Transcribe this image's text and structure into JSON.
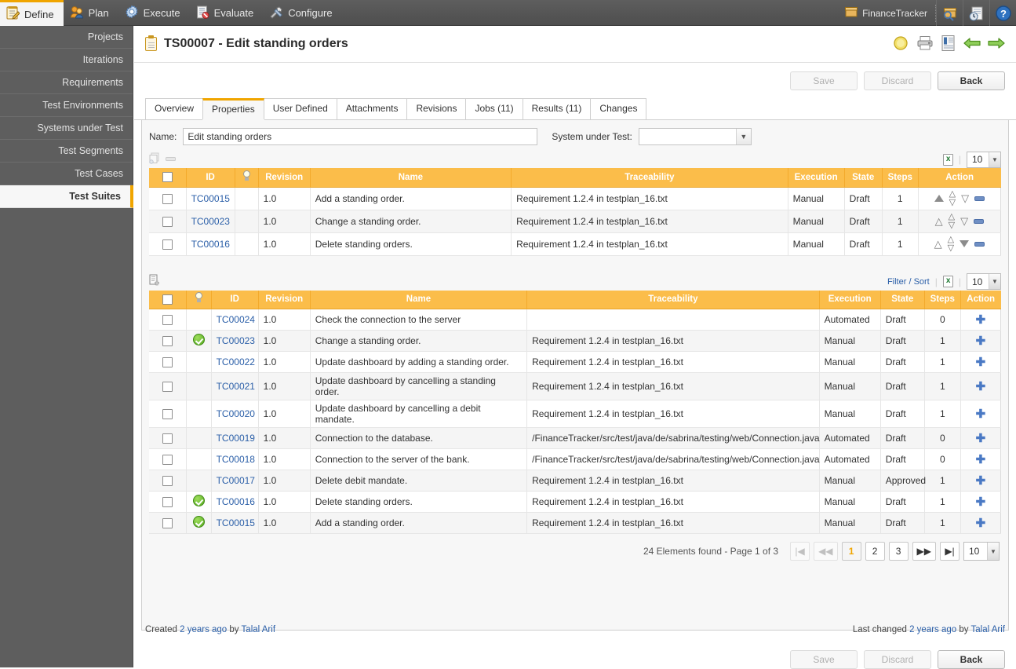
{
  "topnav": {
    "items": [
      {
        "label": "Define",
        "icon": "notepad-icon",
        "active": true
      },
      {
        "label": "Plan",
        "icon": "people-icon",
        "active": false
      },
      {
        "label": "Execute",
        "icon": "gear-icon",
        "active": false
      },
      {
        "label": "Evaluate",
        "icon": "report-icon",
        "active": false
      },
      {
        "label": "Configure",
        "icon": "tools-icon",
        "active": false
      }
    ],
    "project_label": "FinanceTracker",
    "right_icons": [
      "search-package-icon",
      "history-icon",
      "help-icon"
    ]
  },
  "sidebar": {
    "items": [
      {
        "label": "Projects",
        "active": false
      },
      {
        "label": "Iterations",
        "active": false
      },
      {
        "label": "Requirements",
        "active": false
      },
      {
        "label": "Test Environments",
        "active": false
      },
      {
        "label": "Systems under Test",
        "active": false
      },
      {
        "label": "Test Segments",
        "active": false
      },
      {
        "label": "Test Cases",
        "active": false
      },
      {
        "label": "Test Suites",
        "active": true
      }
    ]
  },
  "page": {
    "title": "TS00007 - Edit standing orders",
    "title_icon": "clipboard-icon",
    "header_icons": [
      "bulb-icon",
      "print-icon",
      "report-icon",
      "back-arrow-icon",
      "forward-arrow-icon"
    ]
  },
  "actions": {
    "save": "Save",
    "discard": "Discard",
    "back": "Back"
  },
  "tabs": [
    {
      "label": "Overview",
      "active": false
    },
    {
      "label": "Properties",
      "active": true
    },
    {
      "label": "User Defined",
      "active": false
    },
    {
      "label": "Attachments",
      "active": false
    },
    {
      "label": "Revisions",
      "active": false
    },
    {
      "label": "Jobs (11)",
      "active": false
    },
    {
      "label": "Results (11)",
      "active": false
    },
    {
      "label": "Changes",
      "active": false
    }
  ],
  "form": {
    "name_label": "Name:",
    "name_value": "Edit standing orders",
    "sut_label": "System under Test:",
    "sut_value": ""
  },
  "table1": {
    "toolbar": {
      "copy_icon": "copy-disabled-icon",
      "remove_icon": "remove-disabled-icon",
      "export_icon": "excel-export-icon",
      "page_size": "10"
    },
    "columns": [
      "",
      "ID",
      "",
      "Revision",
      "Name",
      "Traceability",
      "Execution",
      "State",
      "Steps",
      "Action"
    ],
    "column_icons": {
      "3": "bulb-icon"
    },
    "rows": [
      {
        "id": "TC00015",
        "bulb": false,
        "revision": "1.0",
        "name": "Add a standing order.",
        "traceability": "Requirement 1.2.4 in testplan_16.txt",
        "execution": "Manual",
        "state": "Draft",
        "steps": "1",
        "up": "filled",
        "down": "empty"
      },
      {
        "id": "TC00023",
        "bulb": false,
        "revision": "1.0",
        "name": "Change a standing order.",
        "traceability": "Requirement 1.2.4 in testplan_16.txt",
        "execution": "Manual",
        "state": "Draft",
        "steps": "1",
        "up": "empty",
        "down": "empty"
      },
      {
        "id": "TC00016",
        "bulb": false,
        "revision": "1.0",
        "name": "Delete standing orders.",
        "traceability": "Requirement 1.2.4 in testplan_16.txt",
        "execution": "Manual",
        "state": "Draft",
        "steps": "1",
        "up": "empty",
        "down": "filled"
      }
    ]
  },
  "table2": {
    "toolbar": {
      "add_icon": "add-document-icon",
      "filter_sort": "Filter / Sort",
      "export_icon": "excel-export-icon",
      "page_size": "10"
    },
    "columns": [
      "",
      "",
      "ID",
      "Revision",
      "Name",
      "Traceability",
      "Execution",
      "State",
      "Steps",
      "Action"
    ],
    "rows": [
      {
        "id": "TC00024",
        "bulb": false,
        "revision": "1.0",
        "name": "Check the connection to the server",
        "traceability": "",
        "execution": "Automated",
        "state": "Draft",
        "steps": "0"
      },
      {
        "id": "TC00023",
        "bulb": true,
        "revision": "1.0",
        "name": "Change a standing order.",
        "traceability": "Requirement 1.2.4 in testplan_16.txt",
        "execution": "Manual",
        "state": "Draft",
        "steps": "1"
      },
      {
        "id": "TC00022",
        "bulb": false,
        "revision": "1.0",
        "name": "Update dashboard by adding a standing order.",
        "traceability": "Requirement 1.2.4 in testplan_16.txt",
        "execution": "Manual",
        "state": "Draft",
        "steps": "1"
      },
      {
        "id": "TC00021",
        "bulb": false,
        "revision": "1.0",
        "name": "Update dashboard by cancelling a standing order.",
        "traceability": "Requirement 1.2.4 in testplan_16.txt",
        "execution": "Manual",
        "state": "Draft",
        "steps": "1"
      },
      {
        "id": "TC00020",
        "bulb": false,
        "revision": "1.0",
        "name": "Update dashboard by cancelling a debit mandate.",
        "traceability": "Requirement 1.2.4 in testplan_16.txt",
        "execution": "Manual",
        "state": "Draft",
        "steps": "1"
      },
      {
        "id": "TC00019",
        "bulb": false,
        "revision": "1.0",
        "name": "Connection to the database.",
        "traceability": "/FinanceTracker/src/test/java/de/sabrina/testing/web/Connection.java",
        "execution": "Automated",
        "state": "Draft",
        "steps": "0"
      },
      {
        "id": "TC00018",
        "bulb": false,
        "revision": "1.0",
        "name": "Connection to the server of the bank.",
        "traceability": "/FinanceTracker/src/test/java/de/sabrina/testing/web/Connection.java",
        "execution": "Automated",
        "state": "Draft",
        "steps": "0"
      },
      {
        "id": "TC00017",
        "bulb": false,
        "revision": "1.0",
        "name": "Delete debit mandate.",
        "traceability": "Requirement 1.2.4 in testplan_16.txt",
        "execution": "Manual",
        "state": "Approved",
        "steps": "1"
      },
      {
        "id": "TC00016",
        "bulb": true,
        "revision": "1.0",
        "name": "Delete standing orders.",
        "traceability": "Requirement 1.2.4 in testplan_16.txt",
        "execution": "Manual",
        "state": "Draft",
        "steps": "1"
      },
      {
        "id": "TC00015",
        "bulb": true,
        "revision": "1.0",
        "name": "Add a standing order.",
        "traceability": "Requirement 1.2.4 in testplan_16.txt",
        "execution": "Manual",
        "state": "Draft",
        "steps": "1"
      }
    ],
    "pagination": {
      "summary": "24 Elements found - Page 1 of 3",
      "first": "|◀",
      "prev": "◀◀",
      "pages": [
        "1",
        "2",
        "3"
      ],
      "current_page": "1",
      "next": "▶▶",
      "last": "▶|",
      "page_size": "10"
    }
  },
  "footer": {
    "created_prefix": "Created ",
    "created_when": "2 years ago",
    "created_by_prefix": " by ",
    "created_by": "Talal Arif",
    "changed_prefix": "Last changed ",
    "changed_when": "2 years ago",
    "changed_by_prefix": " by ",
    "changed_by": "Talal Arif"
  },
  "colors": {
    "accent": "#f0a500",
    "table_header": "#fbbd4a",
    "link": "#2b5fa8",
    "nav_bg": "#5e5e5e"
  }
}
